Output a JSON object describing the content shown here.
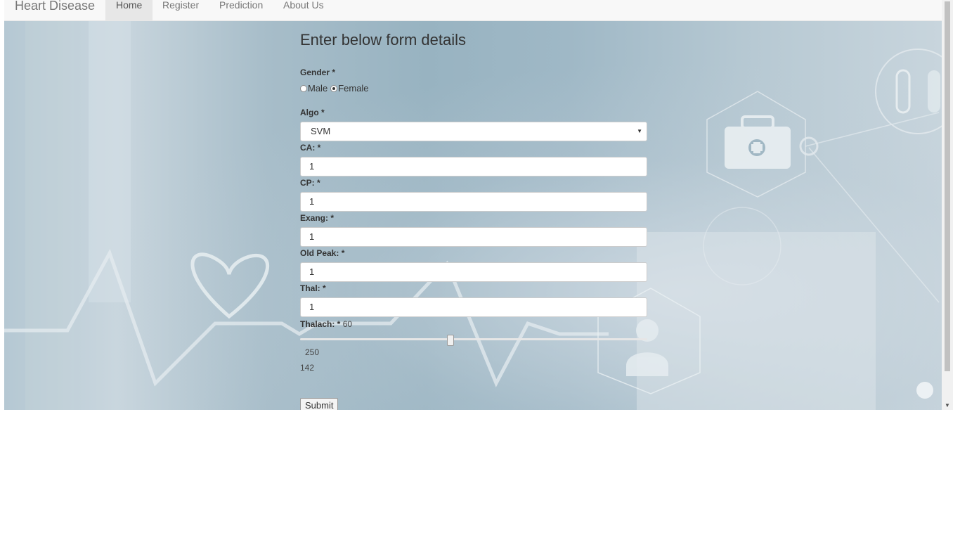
{
  "navbar": {
    "brand": "Heart Disease",
    "items": [
      {
        "label": "Home",
        "active": true
      },
      {
        "label": "Register",
        "active": false
      },
      {
        "label": "Prediction",
        "active": false
      },
      {
        "label": "About Us",
        "active": false
      }
    ]
  },
  "form": {
    "title": "Enter below form details",
    "gender": {
      "label": "Gender *",
      "options": [
        {
          "label": "Male",
          "checked": false
        },
        {
          "label": "Female",
          "checked": true
        }
      ]
    },
    "algo": {
      "label": "Algo *",
      "selected": "SVM"
    },
    "fields": [
      {
        "label": "CA: *",
        "value": "1"
      },
      {
        "label": "CP: *",
        "value": "1"
      },
      {
        "label": "Exang: *",
        "value": "1"
      },
      {
        "label": "Old Peak: *",
        "value": "1"
      },
      {
        "label": "Thal: *",
        "value": "1"
      }
    ],
    "thalach": {
      "label": "Thalach: *",
      "min_label": "60",
      "max_label": "250",
      "current_value": "142",
      "min": 60,
      "max": 250,
      "value": 142
    },
    "submit_label": "Submit"
  }
}
